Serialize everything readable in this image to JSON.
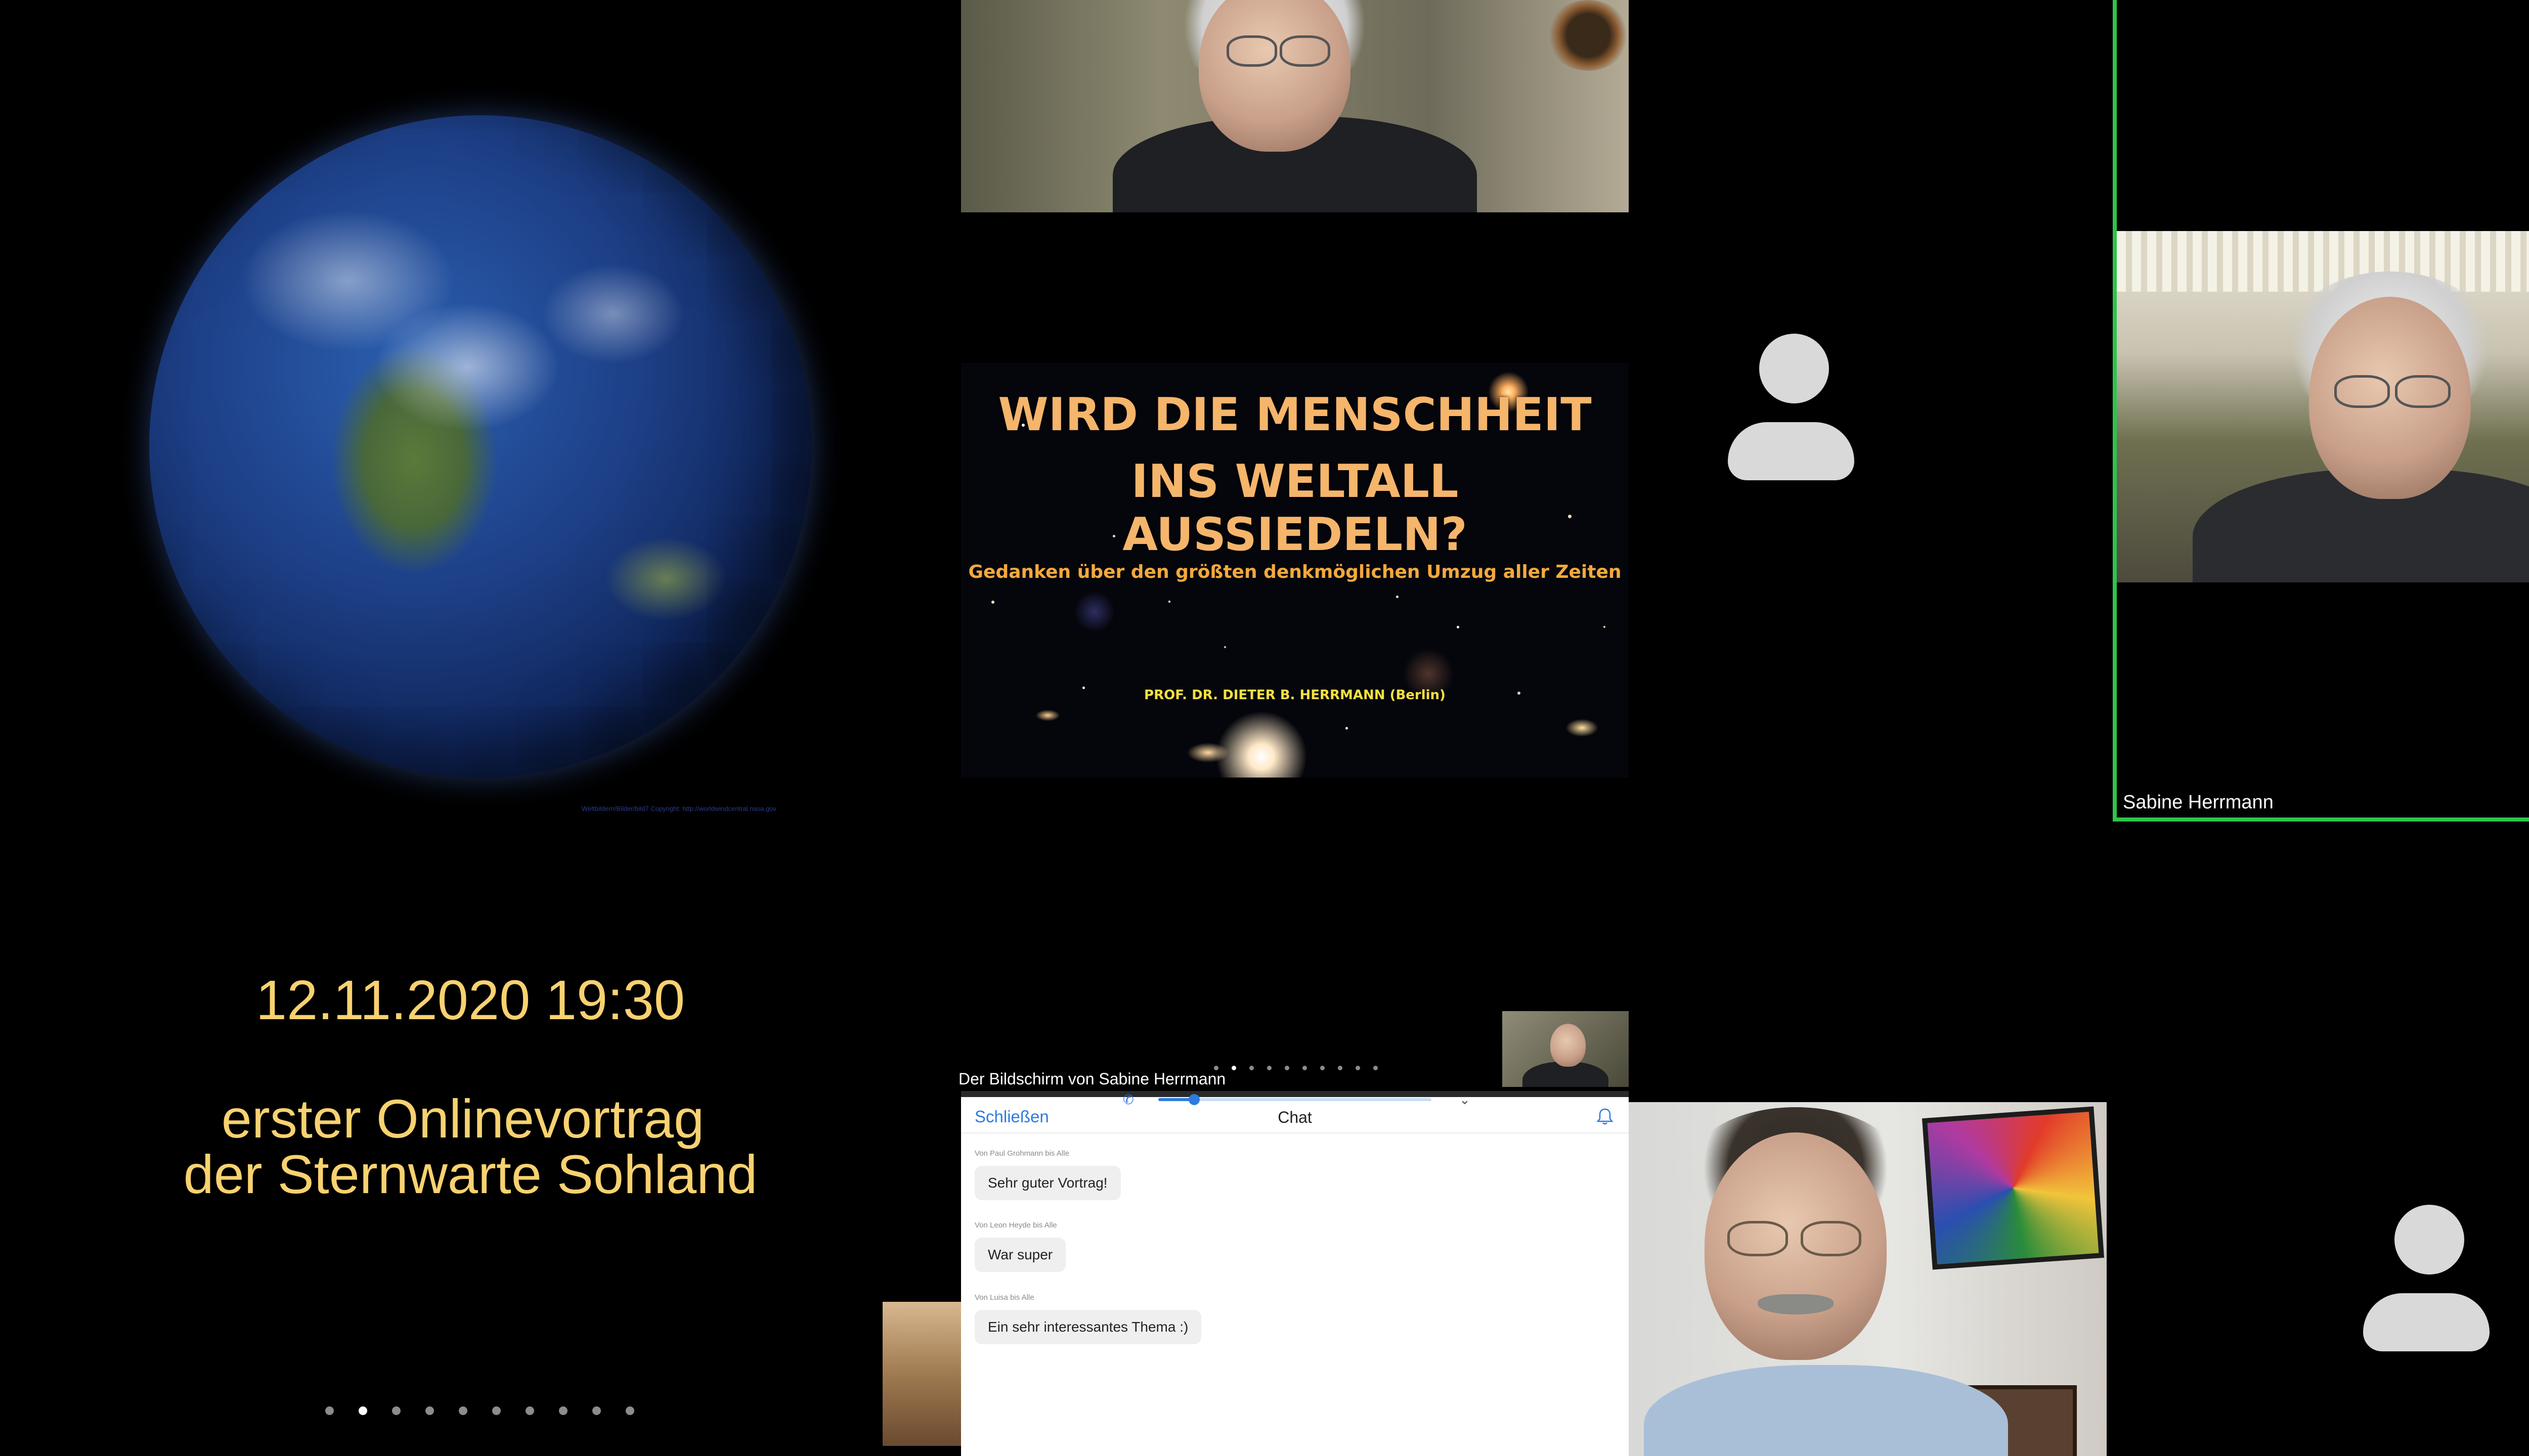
{
  "event": {
    "date": "12.11.2020 19:30",
    "line1": "erster Onlinevortrag",
    "line2": "der Sternwarte Sohland",
    "image_credit": "Weltbildern/Bilder/bild7 Copyright: http://worldwindcentral.nasa.gov",
    "carousel_active": 1
  },
  "slide": {
    "title_line1": "WIRD DIE MENSCHHEIT",
    "title_line2": "INS WELTALL AUSSIEDELN?",
    "subtitle": "Gedanken über den größten denkmöglichen Umzug aller Zeiten",
    "author": "PROF. DR. DIETER B. HERRMANN (Berlin)"
  },
  "active_speaker": {
    "name": "Sabine Herrmann",
    "frame_color": "#2fc34c"
  },
  "screen_share": {
    "label": "Der Bildschirm von Sabine Herrmann",
    "carousel_active": 1
  },
  "chat": {
    "close_label": "Schließen",
    "title": "Chat",
    "accent_color": "#2d7be0",
    "messages": [
      {
        "meta": "Von Paul Grohmann bis Alle",
        "text": "Sehr guter Vortrag!"
      },
      {
        "meta": "Von Leon Heyde bis Alle",
        "text": "War super"
      },
      {
        "meta": "Von Luisa bis Alle",
        "text": "Ein sehr interessantes Thema :)"
      }
    ]
  },
  "icons": {
    "phone": "phone-icon",
    "chevron": "chevron-down-icon",
    "bell": "bell-icon",
    "avatar": "user-avatar-icon"
  }
}
